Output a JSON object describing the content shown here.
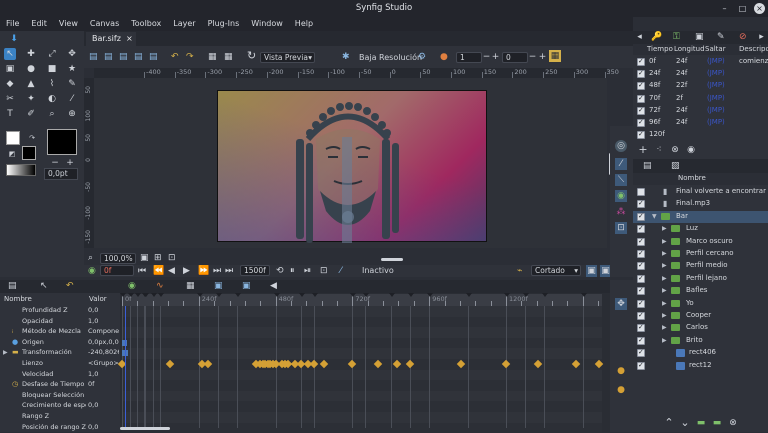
{
  "app_title": "Synfig Studio",
  "menu": [
    "File",
    "Edit",
    "View",
    "Canvas",
    "Toolbox",
    "Layer",
    "Plug-Ins",
    "Window",
    "Help"
  ],
  "doc_tab": "Bar.sifz",
  "toolbar": {
    "preview_mode": "Vista Previa",
    "low_res_label": "Baja Resolución",
    "onion_past": "1",
    "onion_future": "0"
  },
  "ruler_labels": [
    "-400",
    "-350",
    "-300",
    "-250",
    "-200",
    "-150",
    "-100",
    "-50",
    "0",
    "50",
    "100",
    "150",
    "200",
    "250",
    "300",
    "350",
    "400"
  ],
  "vruler_labels": [
    "50",
    "100",
    "50",
    "0",
    "-50",
    "-100",
    "-150"
  ],
  "canvas": {
    "zoom": "100,0%",
    "brush_size": "0,0pt"
  },
  "playback": {
    "current_frame": "0f",
    "end_frame": "1500f",
    "status": "Inactivo",
    "interpolation": "Cortado"
  },
  "params": {
    "header": {
      "name": "Nombre",
      "value": "Valor"
    },
    "rows": [
      {
        "name": "Profundidad Z",
        "value": "0,0"
      },
      {
        "name": "Opacidad",
        "value": "1,0"
      },
      {
        "name": "Método de Mezcla",
        "value": "Componer"
      },
      {
        "name": "Origen",
        "value": "0,0px,0,0px"
      },
      {
        "name": "Transformación",
        "value": "-240,80268"
      },
      {
        "name": "Lienzo",
        "value": "<Grupo>"
      },
      {
        "name": "Velocidad",
        "value": "1,0"
      },
      {
        "name": "Desfase de Tiempo",
        "value": "0f"
      },
      {
        "name": "Bloquear Selección",
        "value": ""
      },
      {
        "name": "Crecimiento de espeso",
        "value": "0,0"
      },
      {
        "name": "Rango Z",
        "value": ""
      },
      {
        "name": "Posición de rango Z",
        "value": "0,0"
      }
    ]
  },
  "timetrack_labels": [
    "0f",
    "240f",
    "480f",
    "720f",
    "960f",
    "1200f"
  ],
  "sound_panel": {
    "headers": [
      "Tiempo",
      "Longitud",
      "Saltar",
      "Descripción"
    ],
    "rows": [
      {
        "time": "0f",
        "length": "24f",
        "skip": "(JMP)",
        "desc": "comienzo"
      },
      {
        "time": "24f",
        "length": "24f",
        "skip": "(JMP)",
        "desc": ""
      },
      {
        "time": "48f",
        "length": "22f",
        "skip": "(JMP)",
        "desc": ""
      },
      {
        "time": "70f",
        "length": "2f",
        "skip": "(JMP)",
        "desc": ""
      },
      {
        "time": "72f",
        "length": "24f",
        "skip": "(JMP)",
        "desc": ""
      },
      {
        "time": "96f",
        "length": "24f",
        "skip": "(JMP)",
        "desc": ""
      },
      {
        "time": "120f",
        "length": "",
        "skip": "",
        "desc": ""
      }
    ]
  },
  "layers": {
    "header": "Nombre",
    "rows": [
      {
        "name": "Final volverte a encontrar",
        "type": "sound",
        "checked": false,
        "indent": 0
      },
      {
        "name": "Final.mp3",
        "type": "sound",
        "checked": true,
        "indent": 0
      },
      {
        "name": "Bar",
        "type": "folder-open",
        "checked": true,
        "indent": 0
      },
      {
        "name": "Luz",
        "type": "folder",
        "checked": true,
        "indent": 1
      },
      {
        "name": "Marco oscuro",
        "type": "folder",
        "checked": true,
        "indent": 1
      },
      {
        "name": "Perfil cercano",
        "type": "folder",
        "checked": true,
        "indent": 1
      },
      {
        "name": "Perfil medio",
        "type": "folder",
        "checked": true,
        "indent": 1
      },
      {
        "name": "Perfil lejano",
        "type": "folder",
        "checked": true,
        "indent": 1
      },
      {
        "name": "Bafles",
        "type": "folder",
        "checked": true,
        "indent": 1
      },
      {
        "name": "Yo",
        "type": "folder",
        "checked": true,
        "indent": 1
      },
      {
        "name": "Cooper",
        "type": "folder",
        "checked": true,
        "indent": 1
      },
      {
        "name": "Carlos",
        "type": "folder",
        "checked": true,
        "indent": 1
      },
      {
        "name": "Brito",
        "type": "folder",
        "checked": true,
        "indent": 1
      },
      {
        "name": "rect406",
        "type": "layer",
        "checked": true,
        "indent": 1
      },
      {
        "name": "rect12",
        "type": "layer",
        "checked": true,
        "indent": 1
      }
    ]
  },
  "colors": {
    "accent": "#3b82c4",
    "selected_row": "#3d5470",
    "keyframe": "#d4a035"
  }
}
